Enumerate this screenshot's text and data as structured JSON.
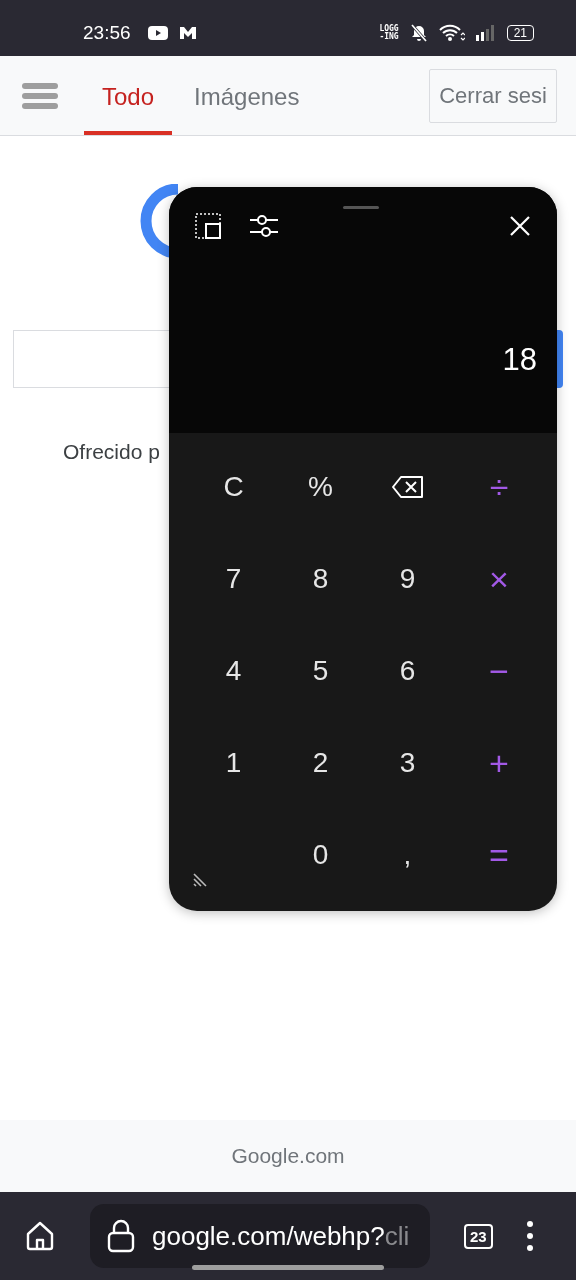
{
  "status_bar": {
    "time": "23:56",
    "indicator_lines": [
      "LOGG",
      "-ING"
    ],
    "battery": "21"
  },
  "header": {
    "tabs": [
      {
        "label": "Todo",
        "selected": true
      },
      {
        "label": "Imágenes",
        "selected": false
      }
    ],
    "sign_out": "Cerrar sesi"
  },
  "page": {
    "offered_by": "Ofrecido p",
    "footer": "Google.com"
  },
  "calculator": {
    "display": "18",
    "keys": [
      {
        "label": "C",
        "kind": "function"
      },
      {
        "label": "%",
        "kind": "function"
      },
      {
        "kind": "backspace"
      },
      {
        "label": "÷",
        "kind": "operator"
      },
      {
        "label": "7",
        "kind": "digit"
      },
      {
        "label": "8",
        "kind": "digit"
      },
      {
        "label": "9",
        "kind": "digit"
      },
      {
        "label": "×",
        "kind": "operator"
      },
      {
        "label": "4",
        "kind": "digit"
      },
      {
        "label": "5",
        "kind": "digit"
      },
      {
        "label": "6",
        "kind": "digit"
      },
      {
        "label": "−",
        "kind": "operator"
      },
      {
        "label": "1",
        "kind": "digit"
      },
      {
        "label": "2",
        "kind": "digit"
      },
      {
        "label": "3",
        "kind": "digit"
      },
      {
        "label": "+",
        "kind": "operator"
      },
      {
        "kind": "blank"
      },
      {
        "label": "0",
        "kind": "digit"
      },
      {
        "label": ",",
        "kind": "digit"
      },
      {
        "label": "=",
        "kind": "operator"
      }
    ]
  },
  "browser_bar": {
    "url": "google.com/webhp?",
    "url_faded": "cli",
    "tab_count": "23"
  }
}
